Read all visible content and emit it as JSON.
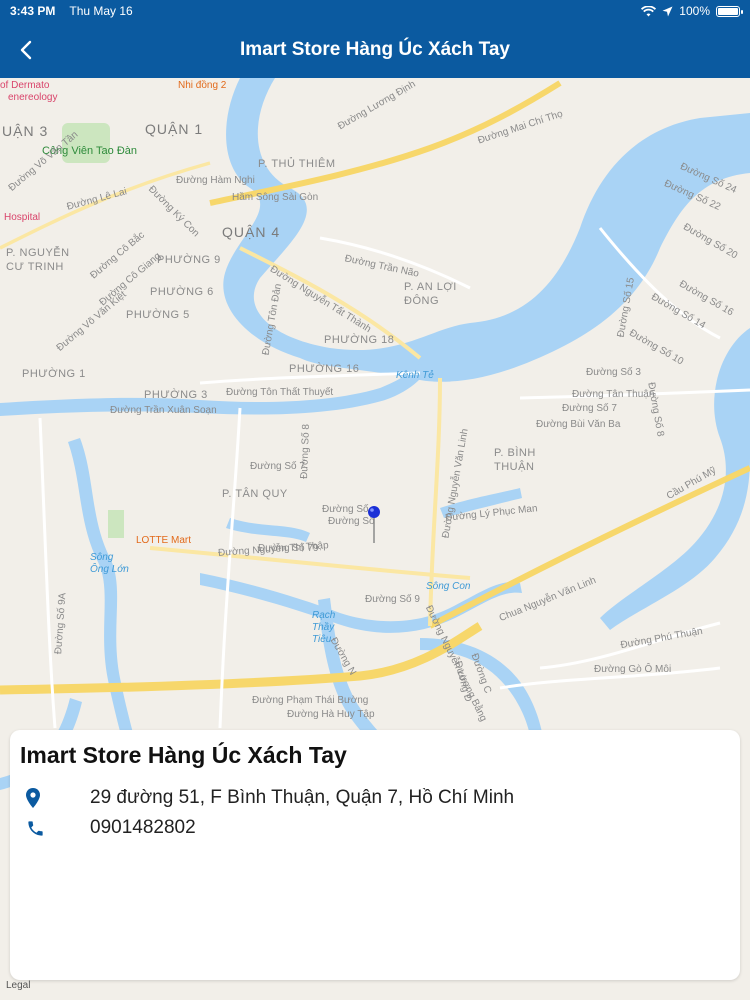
{
  "status_bar": {
    "time": "3:43 PM",
    "date": "Thu May 16",
    "battery": "100%"
  },
  "nav": {
    "title": "Imart Store Hàng Úc Xách Tay"
  },
  "map": {
    "legal": "Legal",
    "labels": {
      "quan3": "UẬN 3",
      "quan1": "QUẬN 1",
      "quan4": "QUẬN 4",
      "thu_thiem": "P. THỦ THIÊM",
      "nguyen_cu_trinh": "P. NGUYỄN CƯ TRINH",
      "phuong9": "PHƯỜNG 9",
      "phuong6": "PHƯỜNG 6",
      "phuong5": "PHƯỜNG 5",
      "phuong18": "PHƯỜNG 18",
      "phuong16": "PHƯỜNG 16",
      "phuong1": "PHƯỜNG 1",
      "phuong3": "PHƯỜNG 3",
      "an_loi_dong": "P. AN LỢI ĐÔNG",
      "binh_thuan": "P. BÌNH THUẬN",
      "tan_quy": "P. TÂN QUY",
      "cong_vien": "Công Viên Tao Đàn",
      "nhi_dong": "Nhi đồng 2",
      "dermato": "of Dermato",
      "venereology": "enereology",
      "hospital": "Hospital",
      "kenh_te": "Kênh Tẻ",
      "song_ong_lon": "Sông Ông Lớn",
      "song_con": "Sông Con",
      "rach_thay_tieu": "Rạch Thầy Tiêu",
      "lotte": "LOTTE Mart",
      "ham_song_sai_gon": "Hầm Sông Sài Gòn",
      "duong_mai_chi_tho": "Đường Mai Chí Thọ",
      "duong_le_lai": "Đường Lê Lai",
      "duong_ham_nghi": "Đường Hàm Nghi",
      "duong_nguyen_tat_thanh": "Đường Nguyễn Tất Thành",
      "duong_tran_xuan_soan": "Đường Trần Xuân Soạn",
      "duong_ton_that_thuyet": "Đường Tôn Thất Thuyết",
      "duong_nguyen_van_linh": "Đường Nguyễn Văn Linh",
      "duong_nguyen_thi_thap": "Đường Nguyễn Thị Thập",
      "duong_so_7": "Đường Số 7",
      "duong_so_79": "Đường Số 79",
      "duong_so_9": "Đường Số 9",
      "duong_so_9a": "Đường Số 9A",
      "duong_ly_phuc_man": "Đường Lý Phục Man",
      "duong_tran_nao": "Đường Trần Não",
      "duong_luong_dinh": "Đường Lương Định",
      "duong_tan_thuan": "Đường Tân Thuận",
      "duong_bui_van_ba": "Đường Bùi Văn Ba",
      "duong_phu_thuan": "Đường Phú Thuận",
      "duong_go_o_moi": "Đường Gò Ô Môi",
      "duong_pham_thai_buong": "Đường Phạm Thái Bường",
      "duong_ha_huy_tap": "Đường Hà Huy Tập",
      "duong_so_24": "Đường Số 24",
      "duong_so_22": "Đường Số 22",
      "duong_so_20": "Đường Số 20",
      "duong_so_16": "Đường Số 16",
      "duong_so_14": "Đường Số 14",
      "duong_so_10": "Đường Số 10",
      "duong_so_15": "Đường Số 15",
      "duong_so_3": "Đường Số 3",
      "duong_so_8": "Đường Số 8",
      "duong_so": "Đường Số",
      "cau_phu_my": "Cầu Phú Mỹ",
      "chua_nguyen_van_linh": "Chua Nguyễn Văn Linh",
      "duong_vo_van_kiet": "Đường Võ Văn Kiệt",
      "duong_co_bac": "Đường Cô Bắc",
      "duong_co_giang": "Đường Cô Giang",
      "duong_ky_con": "Đường Ký Con",
      "duong_ton_dan": "Đường Tôn Đản",
      "duong_so_ba": "Đường Số 8",
      "duong_nguyen_luong_bang": "Đường Nguyễn Lương Bằng",
      "duong_c": "Đường C",
      "duong_d": "Đường D",
      "duong_n": "Đường N",
      "duong_vo_van_tan": "Đường Võ Văn Tần"
    }
  },
  "store": {
    "name": "Imart Store Hàng Úc Xách Tay",
    "address": "29 đường 51, F Bình Thuận, Quận 7, Hồ Chí Minh",
    "phone": "0901482802"
  },
  "colors": {
    "nav_bg": "#0b5aa0",
    "water": "#a9d3f5",
    "land": "#f2efe9",
    "road": "#f7d76b",
    "accent_icon": "#0b5aa0",
    "pin": "#1a2fd6"
  }
}
